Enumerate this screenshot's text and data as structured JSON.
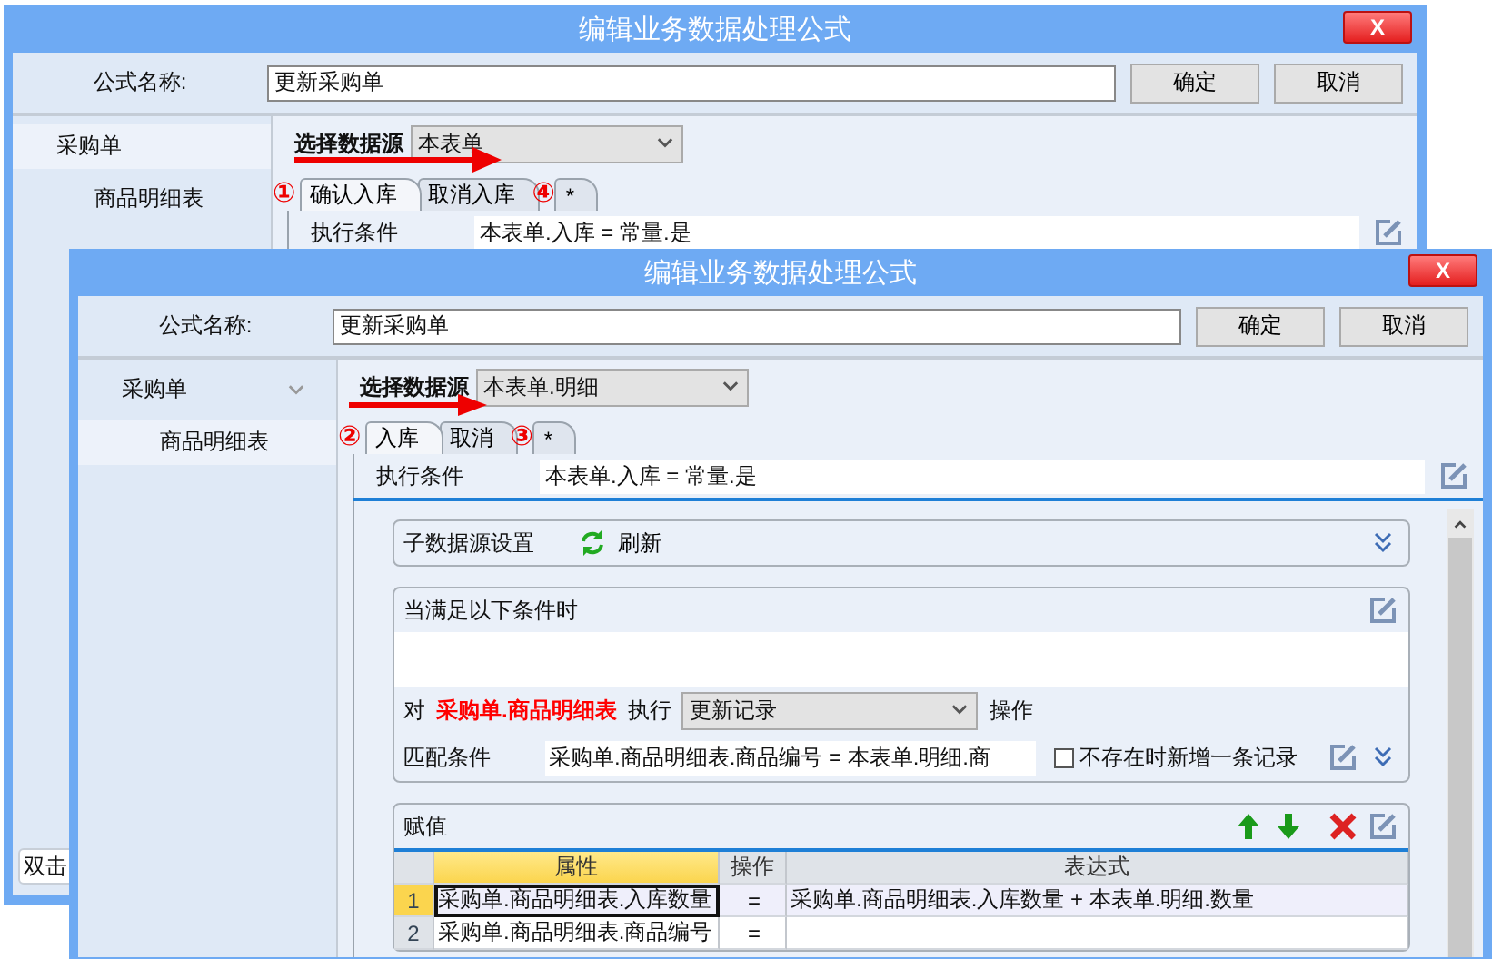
{
  "windows": [
    {
      "title": "编辑业务数据处理公式",
      "close": "X",
      "name_label": "公式名称:",
      "name_value": "更新采购单",
      "buttons": [
        "确定",
        "取消"
      ],
      "sidebar": [
        {
          "label": "采购单",
          "selected": true,
          "children": [
            {
              "label": "商品明细表",
              "selected": false
            }
          ]
        }
      ],
      "sidebar_hint": "双击",
      "source_label": "选择数据源",
      "source_value": "本表单",
      "tabs": [
        {
          "label": "确认入库",
          "selected": true
        },
        {
          "label": "取消入库",
          "selected": false
        },
        {
          "label": "*",
          "selected": false
        }
      ],
      "tab_annotations": {
        "before": "①",
        "after": "④"
      },
      "condition_label": "执行条件",
      "condition_value": "本表单.入库 = 常量.是"
    },
    {
      "title": "编辑业务数据处理公式",
      "close": "X",
      "name_label": "公式名称:",
      "name_value": "更新采购单",
      "buttons": [
        "确定",
        "取消"
      ],
      "sidebar": [
        {
          "label": "采购单",
          "expanded": true,
          "selected": false,
          "children": [
            {
              "label": "商品明细表",
              "selected": true
            }
          ]
        }
      ],
      "source_label": "选择数据源",
      "source_value": "本表单.明细",
      "tabs": [
        {
          "label": "入库",
          "selected": true
        },
        {
          "label": "取消",
          "selected": false
        },
        {
          "label": "*",
          "selected": false
        }
      ],
      "tab_annotations": {
        "before": "②",
        "after": "③"
      },
      "condition_label": "执行条件",
      "condition_value": "本表单.入库 = 常量.是",
      "subsource_panel": {
        "title": "子数据源设置",
        "refresh": "刷新"
      },
      "condition_panel": {
        "title": "当满足以下条件时",
        "target_prefix": "对",
        "target": "采购单.商品明细表",
        "action_label": "执行",
        "action_value": "更新记录",
        "action_suffix": "操作",
        "match_label": "匹配条件",
        "match_value": "采购单.商品明细表.商品编号 = 本表单.明细.商",
        "add_if_missing": {
          "label": "不存在时新增一条记录",
          "checked": false
        }
      },
      "assign_panel": {
        "title": "赋值",
        "table": {
          "columns": [
            {
              "label": "属性",
              "selected": true
            },
            {
              "label": "操作",
              "selected": false
            },
            {
              "label": "表达式",
              "selected": false
            }
          ],
          "rows": [
            {
              "index": "1",
              "selected": true,
              "property": "采购单.商品明细表.入库数量",
              "operator": "=",
              "expression": "采购单.商品明细表.入库数量 + 本表单.明细.数量"
            },
            {
              "index": "2",
              "selected": false,
              "property": "采购单.商品明细表.商品编号",
              "operator": "="
            }
          ]
        }
      }
    }
  ]
}
